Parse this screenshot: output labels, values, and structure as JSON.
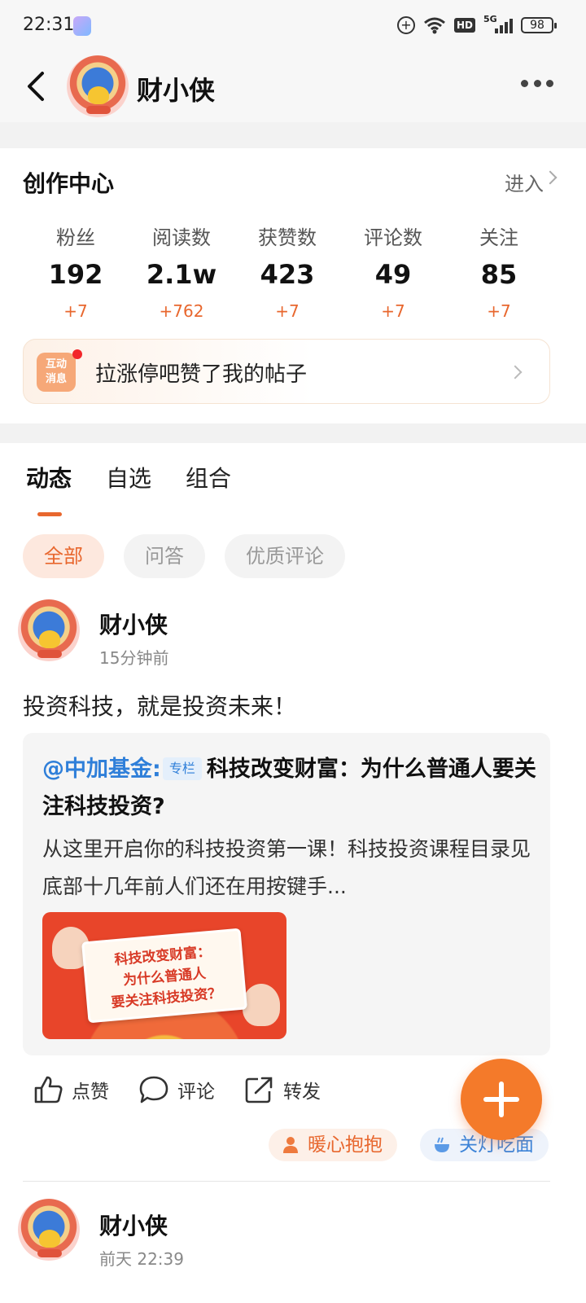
{
  "status_bar": {
    "time": "22:31",
    "network": "5G",
    "hd_label": "HD",
    "battery": "98"
  },
  "header": {
    "back_icon": "back-chevron-icon",
    "title": "财小侠",
    "more_icon": "more-dots-icon"
  },
  "creator_center": {
    "title": "创作中心",
    "enter_label": "进入",
    "stats": [
      {
        "label": "粉丝",
        "value": "192",
        "delta": "+7"
      },
      {
        "label": "阅读数",
        "value": "2.1w",
        "delta": "+762"
      },
      {
        "label": "获赞数",
        "value": "423",
        "delta": "+7"
      },
      {
        "label": "评论数",
        "value": "49",
        "delta": "+7"
      },
      {
        "label": "关注",
        "value": "85",
        "delta": "+7"
      }
    ],
    "notice": {
      "icon_line1": "互动",
      "icon_line2": "消息",
      "text": "拉涨停吧赞了我的帖子"
    }
  },
  "tabs": [
    {
      "label": "动态",
      "active": true
    },
    {
      "label": "自选",
      "active": false
    },
    {
      "label": "组合",
      "active": false
    }
  ],
  "filters": [
    {
      "label": "全部",
      "active": true
    },
    {
      "label": "问答",
      "active": false
    },
    {
      "label": "优质评论",
      "active": false
    }
  ],
  "posts": [
    {
      "author": "财小侠",
      "time": "15分钟前",
      "text": "投资科技，就是投资未来！",
      "quote": {
        "mention": "@中加基金:",
        "tag": "专栏",
        "title": "科技改变财富：为什么普通人要关注科技投资?",
        "body": "从这里开启你的科技投资第一课！科技投资课程目录见底部十几年前人们还在用按键手...",
        "image_line1": "科技改变财富：",
        "image_line2": "为什么普通人",
        "image_line3": "要关注科技投资？"
      },
      "actions": {
        "like": "点赞",
        "comment": "评论",
        "share": "转发"
      },
      "reactions": [
        "暖心抱抱",
        "关灯吃面"
      ]
    },
    {
      "author": "财小侠",
      "time": "前天 22:39"
    }
  ],
  "colors": {
    "accent": "#e8672e",
    "link": "#2f7fd9",
    "fab": "#f47a2a"
  }
}
